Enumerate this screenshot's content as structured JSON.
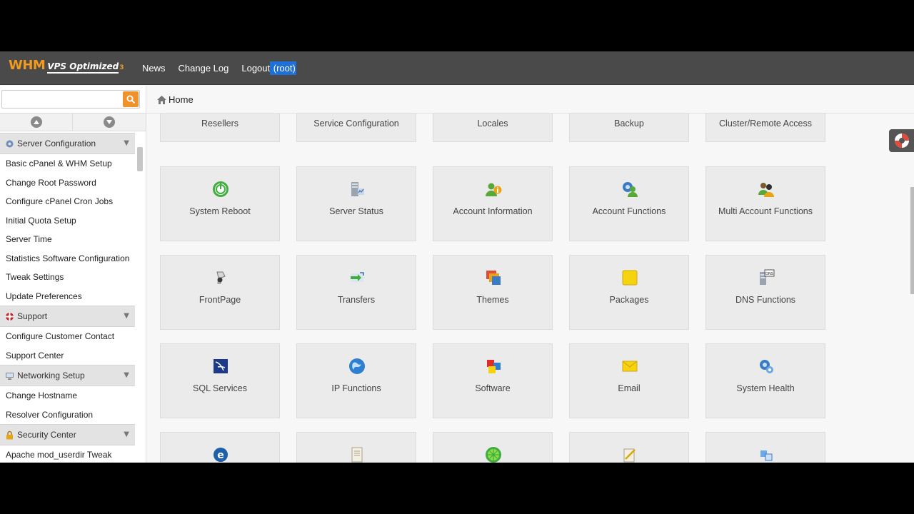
{
  "header": {
    "logo_main": "WHM",
    "logo_sub": "VPS Optimized",
    "logo_num": "3",
    "nav": [
      {
        "label": "News"
      },
      {
        "label": "Change Log"
      },
      {
        "label": "Logout"
      }
    ],
    "logout_user": " (root)"
  },
  "search": {
    "value": "",
    "placeholder": ""
  },
  "breadcrumb": {
    "home": "Home"
  },
  "sidebar": {
    "groups": [
      {
        "label": "Server Configuration",
        "icon": "gear-icon",
        "items": [
          "Basic cPanel & WHM Setup",
          "Change Root Password",
          "Configure cPanel Cron Jobs",
          "Initial Quota Setup",
          "Server Time",
          "Statistics Software Configuration",
          "Tweak Settings",
          "Update Preferences"
        ]
      },
      {
        "label": "Support",
        "icon": "lifebuoy-icon",
        "items": [
          "Configure Customer Contact",
          "Support Center"
        ]
      },
      {
        "label": "Networking Setup",
        "icon": "network-icon",
        "items": [
          "Change Hostname",
          "Resolver Configuration"
        ]
      },
      {
        "label": "Security Center",
        "icon": "lock-icon",
        "items": [
          "Apache mod_userdir Tweak"
        ]
      }
    ]
  },
  "tiles": {
    "row0": [
      "Resellers",
      "Service Configuration",
      "Locales",
      "Backup",
      "Cluster/Remote Access"
    ],
    "row1": [
      "System Reboot",
      "Server Status",
      "Account Information",
      "Account Functions",
      "Multi Account Functions"
    ],
    "row2": [
      "FrontPage",
      "Transfers",
      "Themes",
      "Packages",
      "DNS Functions"
    ],
    "row3": [
      "SQL Services",
      "IP Functions",
      "Software",
      "Email",
      "System Health"
    ]
  },
  "colors": {
    "accent": "#f0922b",
    "topbar": "#4a4a4a",
    "highlight": "#1e6fd6"
  }
}
